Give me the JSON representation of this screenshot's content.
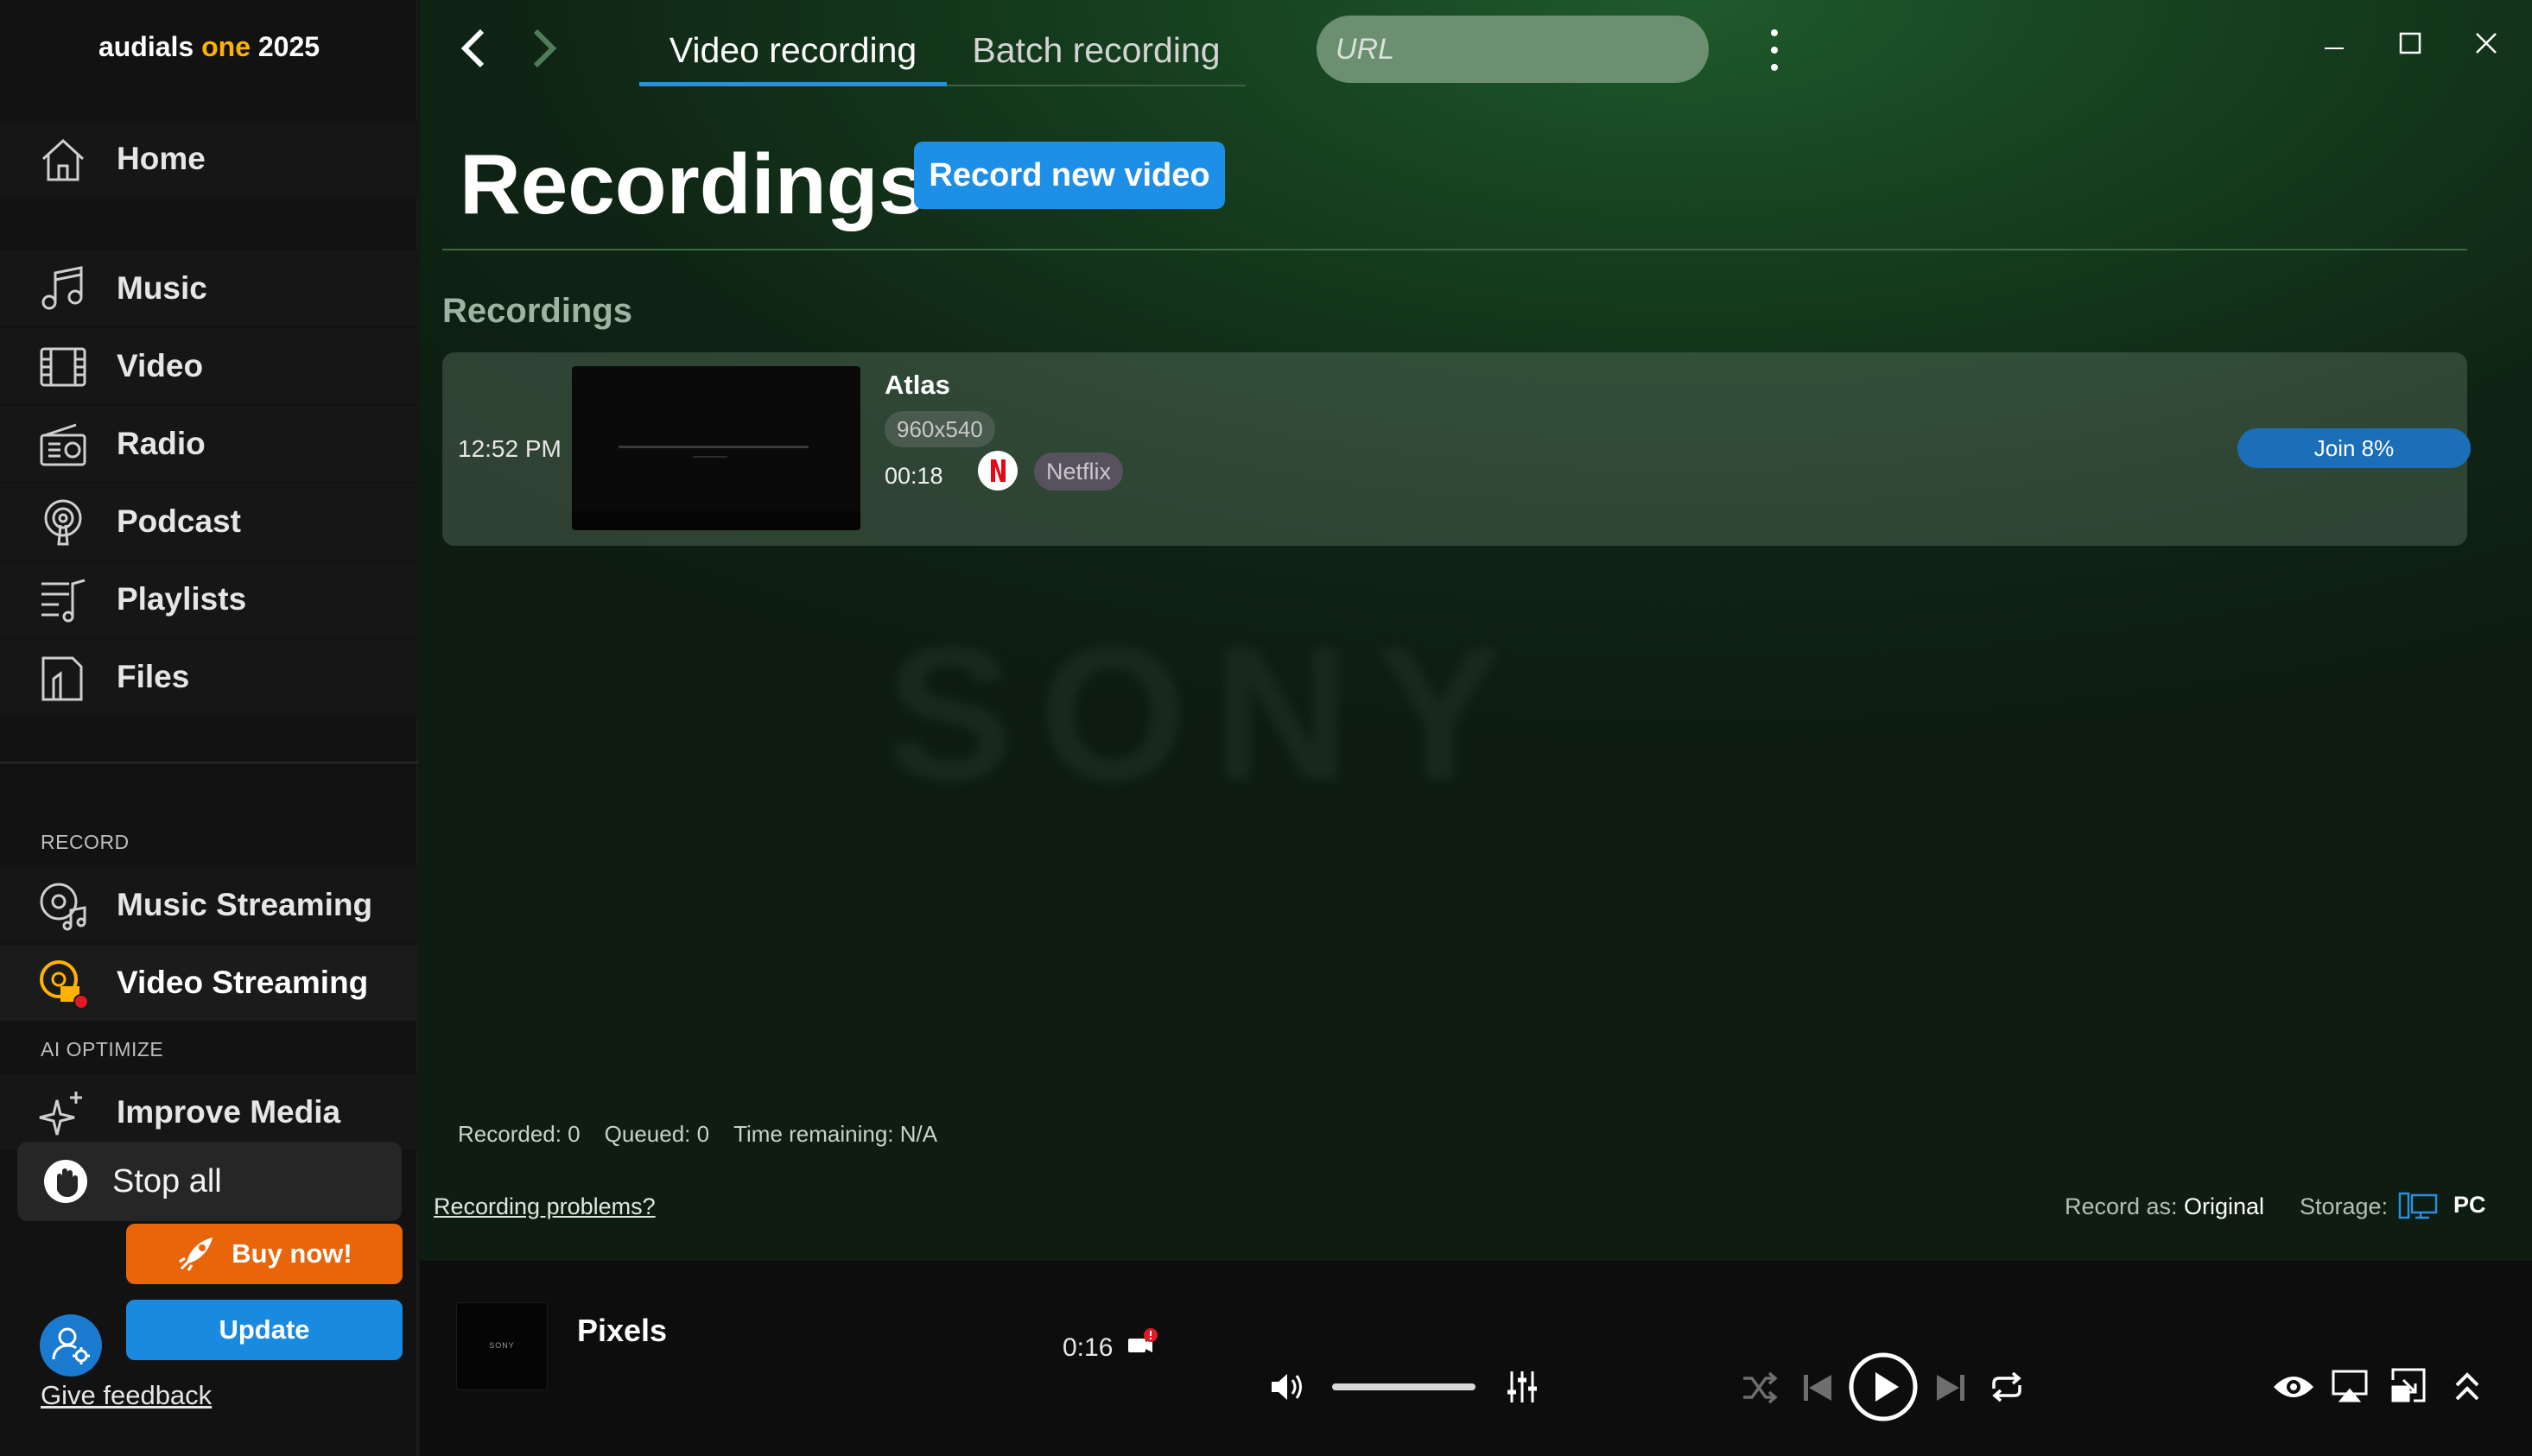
{
  "app": {
    "title_main": "audials ",
    "title_accent": "one",
    "title_year": " 2025"
  },
  "sidebar": {
    "items": [
      {
        "label": "Home",
        "icon": "home-icon"
      },
      {
        "label": "Music",
        "icon": "music-icon"
      },
      {
        "label": "Video",
        "icon": "film-icon"
      },
      {
        "label": "Radio",
        "icon": "radio-icon"
      },
      {
        "label": "Podcast",
        "icon": "podcast-icon"
      },
      {
        "label": "Playlists",
        "icon": "playlist-icon"
      },
      {
        "label": "Files",
        "icon": "files-icon"
      }
    ],
    "record_section": "RECORD",
    "record_items": [
      {
        "label": "Music Streaming",
        "icon": "music-streaming-icon"
      },
      {
        "label": "Video Streaming",
        "icon": "video-streaming-icon"
      }
    ],
    "ai_section": "AI OPTIMIZE",
    "ai_items": [
      {
        "label": "Improve Media",
        "icon": "sparkle-icon"
      }
    ],
    "stop_all": "Stop all",
    "buy_now": "Buy now!",
    "update": "Update",
    "feedback": "Give feedback"
  },
  "header": {
    "tabs": [
      {
        "label": "Video recording",
        "active": true
      },
      {
        "label": "Batch recording",
        "active": false
      }
    ],
    "url_placeholder": "URL"
  },
  "main": {
    "page_title": "Recordings",
    "record_new_label": "Record new video",
    "section_title": "Recordings",
    "recordings": [
      {
        "time": "12:52 PM",
        "title": "Atlas",
        "resolution": "960x540",
        "duration": "00:18",
        "source": "Netflix",
        "action": "Join 8%"
      }
    ],
    "watermark": "SONY",
    "stats": {
      "recorded": "Recorded: 0",
      "queued": "Queued: 0",
      "remaining": "Time remaining: N/A"
    },
    "recording_problems": "Recording problems?",
    "record_as_label": "Record as:",
    "record_as_value": "Original",
    "storage_label": "Storage:",
    "storage_value": "PC"
  },
  "player": {
    "title": "Pixels",
    "time": "0:16",
    "thumb_label": "SONY"
  },
  "colors": {
    "accent": "#ffb300",
    "primary": "#1d8fe6",
    "buy": "#e8650a",
    "record_red": "#e01b24"
  }
}
